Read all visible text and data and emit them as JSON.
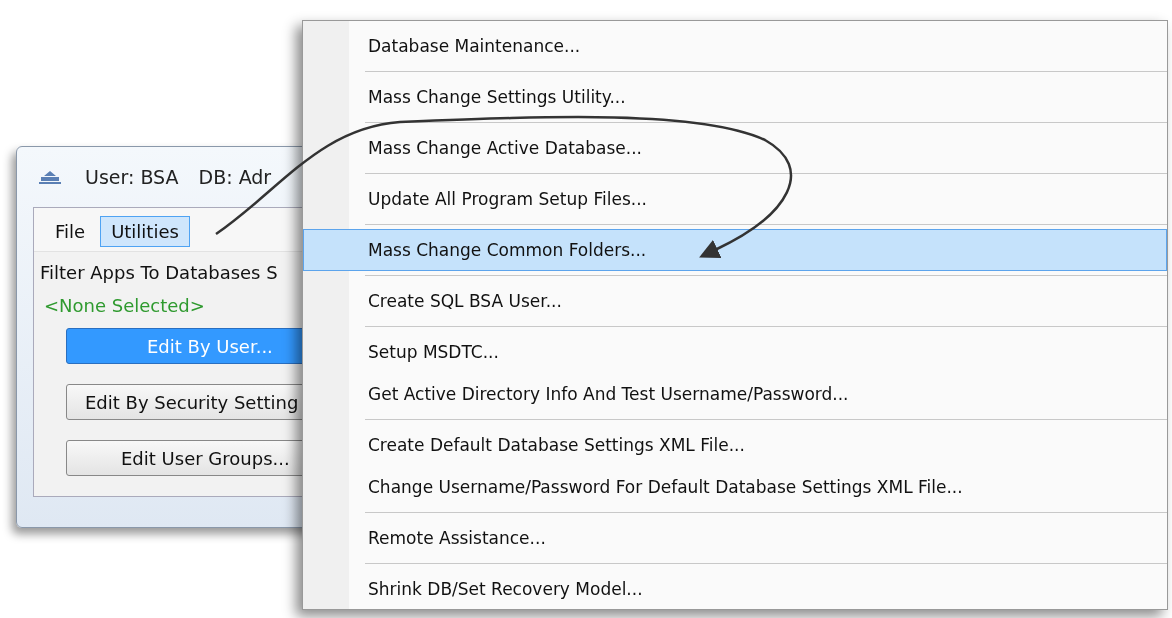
{
  "window": {
    "title_user": "User: BSA",
    "title_db": "DB: Adr"
  },
  "menubar": [
    {
      "label": "File",
      "selected": false
    },
    {
      "label": "Utilities",
      "selected": true
    }
  ],
  "filter_label": "Filter Apps To Databases S",
  "filter_value": "<None Selected>",
  "buttons": [
    {
      "label": "Edit By User...",
      "selected": true
    },
    {
      "label": "Edit By Security Setting",
      "selected": false
    },
    {
      "label": "Edit User Groups...",
      "selected": false
    }
  ],
  "menu_groups": [
    {
      "items": [
        {
          "label": "Database Maintenance...",
          "selected": false
        }
      ]
    },
    {
      "items": [
        {
          "label": "Mass Change Settings Utility...",
          "selected": false
        }
      ]
    },
    {
      "items": [
        {
          "label": "Mass Change Active Database...",
          "selected": false
        }
      ]
    },
    {
      "items": [
        {
          "label": "Update All Program Setup Files...",
          "selected": false
        }
      ]
    },
    {
      "items": [
        {
          "label": "Mass Change Common Folders...",
          "selected": true
        }
      ]
    },
    {
      "items": [
        {
          "label": "Create SQL BSA User...",
          "selected": false
        }
      ]
    },
    {
      "items": [
        {
          "label": "Setup MSDTC...",
          "selected": false
        },
        {
          "label": "Get Active Directory Info And Test Username/Password...",
          "selected": false
        }
      ]
    },
    {
      "items": [
        {
          "label": "Create Default Database Settings XML File...",
          "selected": false
        },
        {
          "label": "Change Username/Password For Default Database Settings XML File...",
          "selected": false
        }
      ]
    },
    {
      "items": [
        {
          "label": "Remote Assistance...",
          "selected": false
        }
      ]
    },
    {
      "items": [
        {
          "label": "Shrink DB/Set Recovery Model...",
          "selected": false
        }
      ]
    }
  ]
}
